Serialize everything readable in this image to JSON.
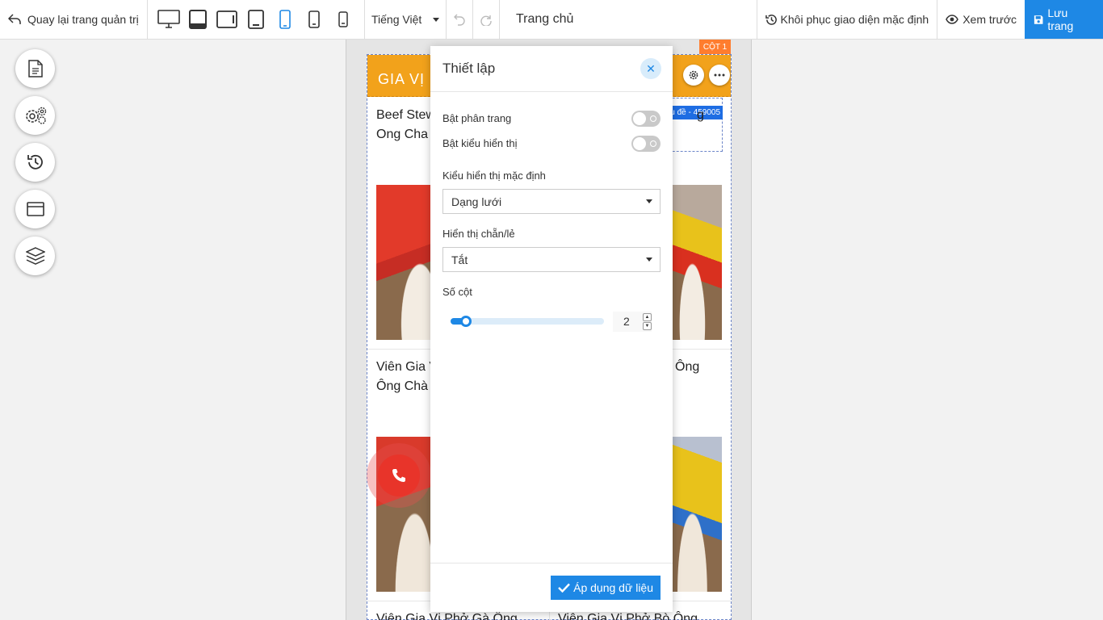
{
  "topbar": {
    "back_label": "Quay lại trang quản trị",
    "language": "Tiếng Việt",
    "page_name": "Trang chủ",
    "restore_label": "Khôi phục giao diện mặc định",
    "preview_label": "Xem trước",
    "save_label": "Lưu trang",
    "devices": [
      "desktop-icon",
      "tablet-landscape-icon",
      "tablet-wide-icon",
      "tablet-icon",
      "phone-large-icon",
      "phone-icon",
      "phone-small-icon"
    ],
    "active_device": "phone-large-icon"
  },
  "rail": [
    "page-icon",
    "settings-gears-icon",
    "history-icon",
    "layout-icon",
    "layers-icon"
  ],
  "canvas": {
    "column_tag": "CỘT 1",
    "banner_text": "GIA VỊ",
    "title_tag": "u đề - 459005",
    "products": [
      {
        "name": "Beef Stew\nOng Cha"
      },
      {
        "name": "g"
      },
      {
        "name": "Viên Gia V\nÔng Chà"
      },
      {
        "name": "Ông"
      },
      {
        "name": "Viên Gia Vị Phở Gà Ông"
      },
      {
        "name": "Viên Gia Vị Phở Bò Ông"
      }
    ]
  },
  "panel": {
    "title": "Thiết lập",
    "toggle_pagination": "Bật phân trang",
    "toggle_display": "Bật kiểu hiển thị",
    "default_display_label": "Kiểu hiển thị mặc định",
    "default_display_value": "Dạng lưới",
    "parity_label": "Hiển thị chẵn/lẻ",
    "parity_value": "Tắt",
    "columns_label": "Số cột",
    "columns_value": "2",
    "columns_slider_fraction": 0.1,
    "apply_label": "Áp dụng dữ liệu"
  },
  "colors": {
    "accent": "#1e88e5",
    "banner": "#f2a21b",
    "column_tag": "#ff7d2e"
  }
}
